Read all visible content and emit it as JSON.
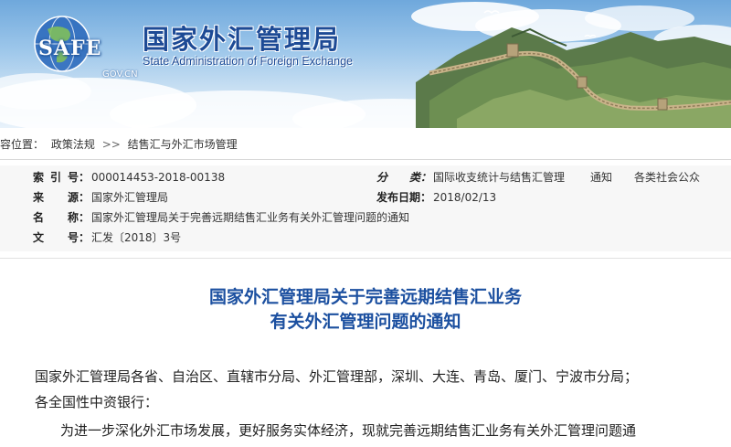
{
  "banner": {
    "logo_text": "SAFE",
    "logo_sub": "GOV.CN",
    "site_title": "国家外汇管理局",
    "site_subtitle": "State Administration of Foreign Exchange"
  },
  "breadcrumb": {
    "prefix": "内容位置：",
    "items": [
      "政策法规",
      "结售汇与外汇市场管理"
    ],
    "separator": ">>"
  },
  "meta": {
    "index_label": [
      "索",
      "引",
      "号："
    ],
    "index_value": "000014453-2018-00138",
    "category_label": [
      "分",
      "类："
    ],
    "category_value": "国际收支统计与结售汇管理",
    "category_type": "通知",
    "category_audience": "各类社会公众",
    "source_label": [
      "来",
      "源："
    ],
    "source_value": "国家外汇管理局",
    "date_label": "发布日期：",
    "date_value": "2018/02/13",
    "name_label": [
      "名",
      "称："
    ],
    "name_value": "国家外汇管理局关于完善远期结售汇业务有关外汇管理问题的通知",
    "docno_label": [
      "文",
      "号："
    ],
    "docno_value": "汇发〔2018〕3号"
  },
  "article": {
    "title_line1": "国家外汇管理局关于完善远期结售汇业务",
    "title_line2": "有关外汇管理问题的通知",
    "addressee_line1": "国家外汇管理局各省、自治区、直辖市分局、外汇管理部，深圳、大连、青岛、厦门、宁波市分局；",
    "addressee_line2": "各全国性中资银行：",
    "body_line1": "为进一步深化外汇市场发展，更好服务实体经济，现就完善远期结售汇业务有关外汇管理问题通"
  },
  "colors": {
    "title_blue": "#1c50a0",
    "banner_text_blue": "#1d4a95",
    "meta_bg": "#f7f7f7"
  }
}
